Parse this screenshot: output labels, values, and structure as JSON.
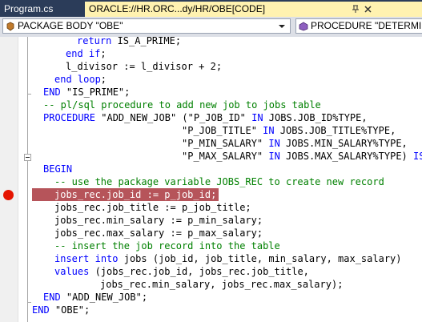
{
  "tabs": [
    {
      "label": "Program.cs",
      "active": false
    },
    {
      "label": "ORACLE://HR.ORC...dy/HR/OBE[CODE]",
      "active": true,
      "pin_icon": "pin-icon",
      "close_icon": "close-icon"
    }
  ],
  "dropdowns": {
    "left": {
      "label": "PACKAGE BODY \"OBE\"",
      "icon": "package-icon"
    },
    "right": {
      "label": "PROCEDURE \"DETERMINE",
      "icon": "procedure-icon"
    }
  },
  "colors": {
    "breakpoint_line": "#b6545a",
    "breakpoint_dot": "#e51400",
    "keyword": "#0000ff",
    "comment": "#008000",
    "tab_bar": "#2b3c59",
    "active_tab": "#fff2b0"
  },
  "code": {
    "l1a": "return",
    "l1b": " IS_A_PRIME;",
    "l2a": "end if",
    "l2b": ";",
    "l3": "l_divisor := l_divisor + 2;",
    "l4a": "end loop",
    "l4b": ";",
    "l5a": "END",
    "l5b": " \"IS_PRIME\";",
    "l6": "-- pl/sql procedure to add new job to jobs table",
    "l7a": "PROCEDURE",
    "l7b": " \"ADD_NEW_JOB\" (\"P_JOB_ID\" ",
    "l7c": "IN",
    "l7d": " JOBS.JOB_ID%TYPE,",
    "l8a": "\"P_JOB_TITLE\" ",
    "l8b": "IN",
    "l8c": " JOBS.JOB_TITLE%TYPE,",
    "l9a": "\"P_MIN_SALARY\" ",
    "l9b": "IN",
    "l9c": " JOBS.MIN_SALARY%TYPE,",
    "l10a": "\"P_MAX_SALARY\" ",
    "l10b": "IN",
    "l10c": " JOBS.MAX_SALARY%TYPE) ",
    "l10d": "IS",
    "l11": "BEGIN",
    "l12": "-- use the package variable JOBS_REC to create new record",
    "l13": "jobs_rec.job_id := p_job_id;",
    "l14": "jobs_rec.job_title := p_job_title;",
    "l15": "jobs_rec.min_salary := p_min_salary;",
    "l16": "jobs_rec.max_salary := p_max_salary;",
    "l17": "-- insert the job record into the table",
    "l18a": "insert",
    "l18b": " ",
    "l18c": "into",
    "l18d": " jobs (job_id, job_title, min_salary, max_salary)",
    "l19a": "values",
    "l19b": " (jobs_rec.job_id, jobs_rec.job_title,",
    "l20": "jobs_rec.min_salary, jobs_rec.max_salary);",
    "l21a": "END",
    "l21b": " \"ADD_NEW_JOB\";",
    "l22a": "END",
    "l22b": " \"OBE\";"
  }
}
